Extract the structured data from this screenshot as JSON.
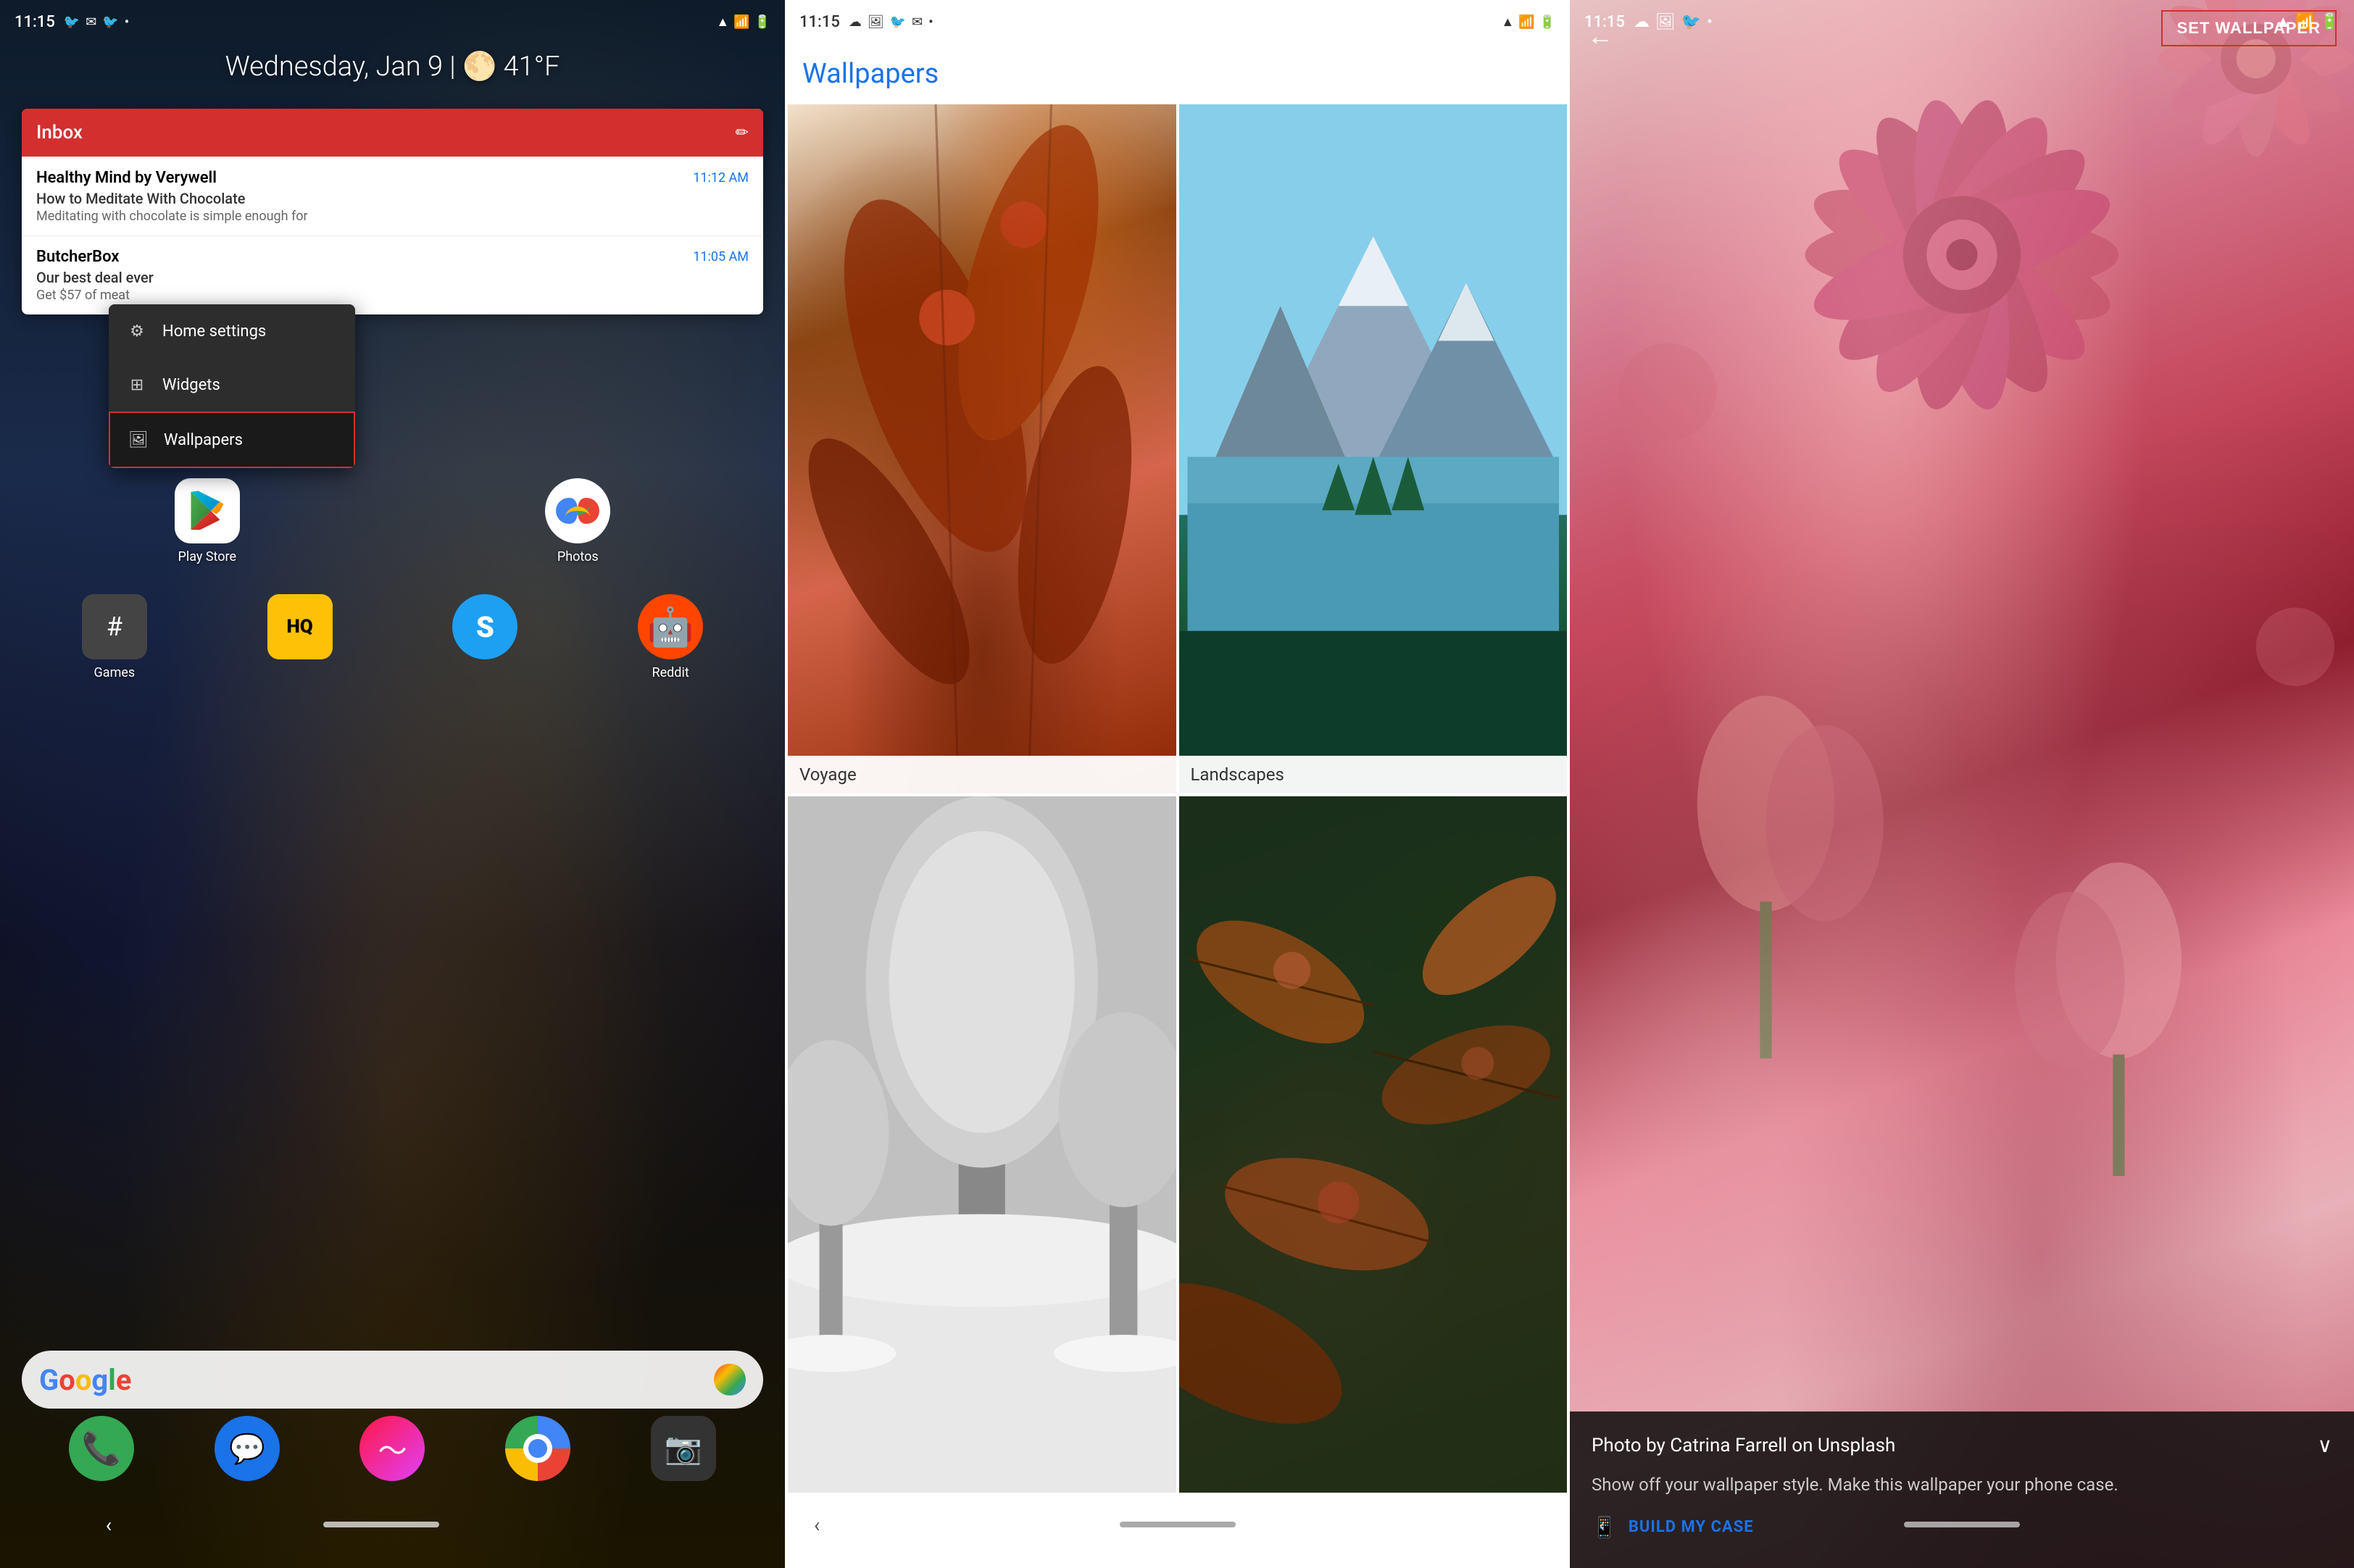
{
  "panels": {
    "home": {
      "status_bar": {
        "time": "11:15",
        "icons": [
          "twitter",
          "mail",
          "twitter",
          "dot"
        ],
        "right_icons": [
          "wifi",
          "signal",
          "battery"
        ]
      },
      "date_weather": "Wednesday, Jan 9  |  🌕  41°F",
      "inbox": {
        "title": "Inbox",
        "edit_icon": "✏",
        "emails": [
          {
            "sender": "Healthy Mind by Verywell",
            "time": "11:12 AM",
            "subject": "How to Meditate With Chocolate",
            "preview": "Meditating with chocolate is simple enough for"
          },
          {
            "sender": "ButcherBox",
            "time": "11:05 AM",
            "subject": "Our best deal ever",
            "preview": "Get $57 of meat"
          }
        ]
      },
      "context_menu": {
        "items": [
          {
            "id": "home-settings",
            "icon": "⚙",
            "label": "Home settings",
            "highlighted": false
          },
          {
            "id": "widgets",
            "icon": "⊞",
            "label": "Widgets",
            "highlighted": false
          },
          {
            "id": "wallpapers",
            "icon": "🖼",
            "label": "Wallpapers",
            "highlighted": true
          }
        ]
      },
      "apps_row1": [
        {
          "id": "play-store",
          "label": "Play Store",
          "color": "#fff"
        },
        {
          "id": "photos",
          "label": "Photos",
          "color": "#fff"
        }
      ],
      "apps_row2": [
        {
          "id": "games",
          "label": "Games",
          "color": "#444"
        },
        {
          "id": "shazam",
          "label": "",
          "color": "#1da0f2"
        },
        {
          "id": "reddit",
          "label": "Reddit",
          "color": "#ff4500"
        }
      ],
      "dock_apps": [
        "phone",
        "messages",
        "spiral",
        "chrome",
        "camera"
      ],
      "search_bar": {
        "g_label": "G",
        "placeholder": ""
      },
      "nav": {
        "back_label": "‹",
        "home_pill": true
      }
    },
    "wallpapers": {
      "status_bar": {
        "time": "11:15",
        "icons": [
          "soundcloud",
          "image",
          "twitter",
          "mail",
          "dot"
        ],
        "right_icons": [
          "wifi",
          "signal",
          "battery"
        ]
      },
      "title": "Wallpapers",
      "categories": [
        {
          "id": "voyage",
          "label": "Voyage",
          "type": "flowers"
        },
        {
          "id": "landscapes",
          "label": "Landscapes",
          "type": "mountains"
        },
        {
          "id": "winter",
          "label": "",
          "type": "winter"
        },
        {
          "id": "leaves",
          "label": "",
          "type": "leaves"
        }
      ],
      "nav": {
        "back_label": "‹",
        "home_pill": true
      }
    },
    "preview": {
      "status_bar": {
        "time": "11:15",
        "icons": [
          "soundcloud",
          "image",
          "twitter",
          "dot"
        ],
        "right_icons": [
          "wifi",
          "signal",
          "battery"
        ]
      },
      "back_label": "←",
      "set_wallpaper_button": "SET WALLPAPER",
      "photo_credit": "Photo by Catrina Farrell on Unsplash",
      "chevron": "∨",
      "description": "Show off your wallpaper style. Make this wallpaper your phone case.",
      "build_case": {
        "icon": "📱",
        "label": "BUILD MY CASE"
      },
      "nav": {
        "back_label": "‹",
        "home_pill": true
      }
    }
  }
}
